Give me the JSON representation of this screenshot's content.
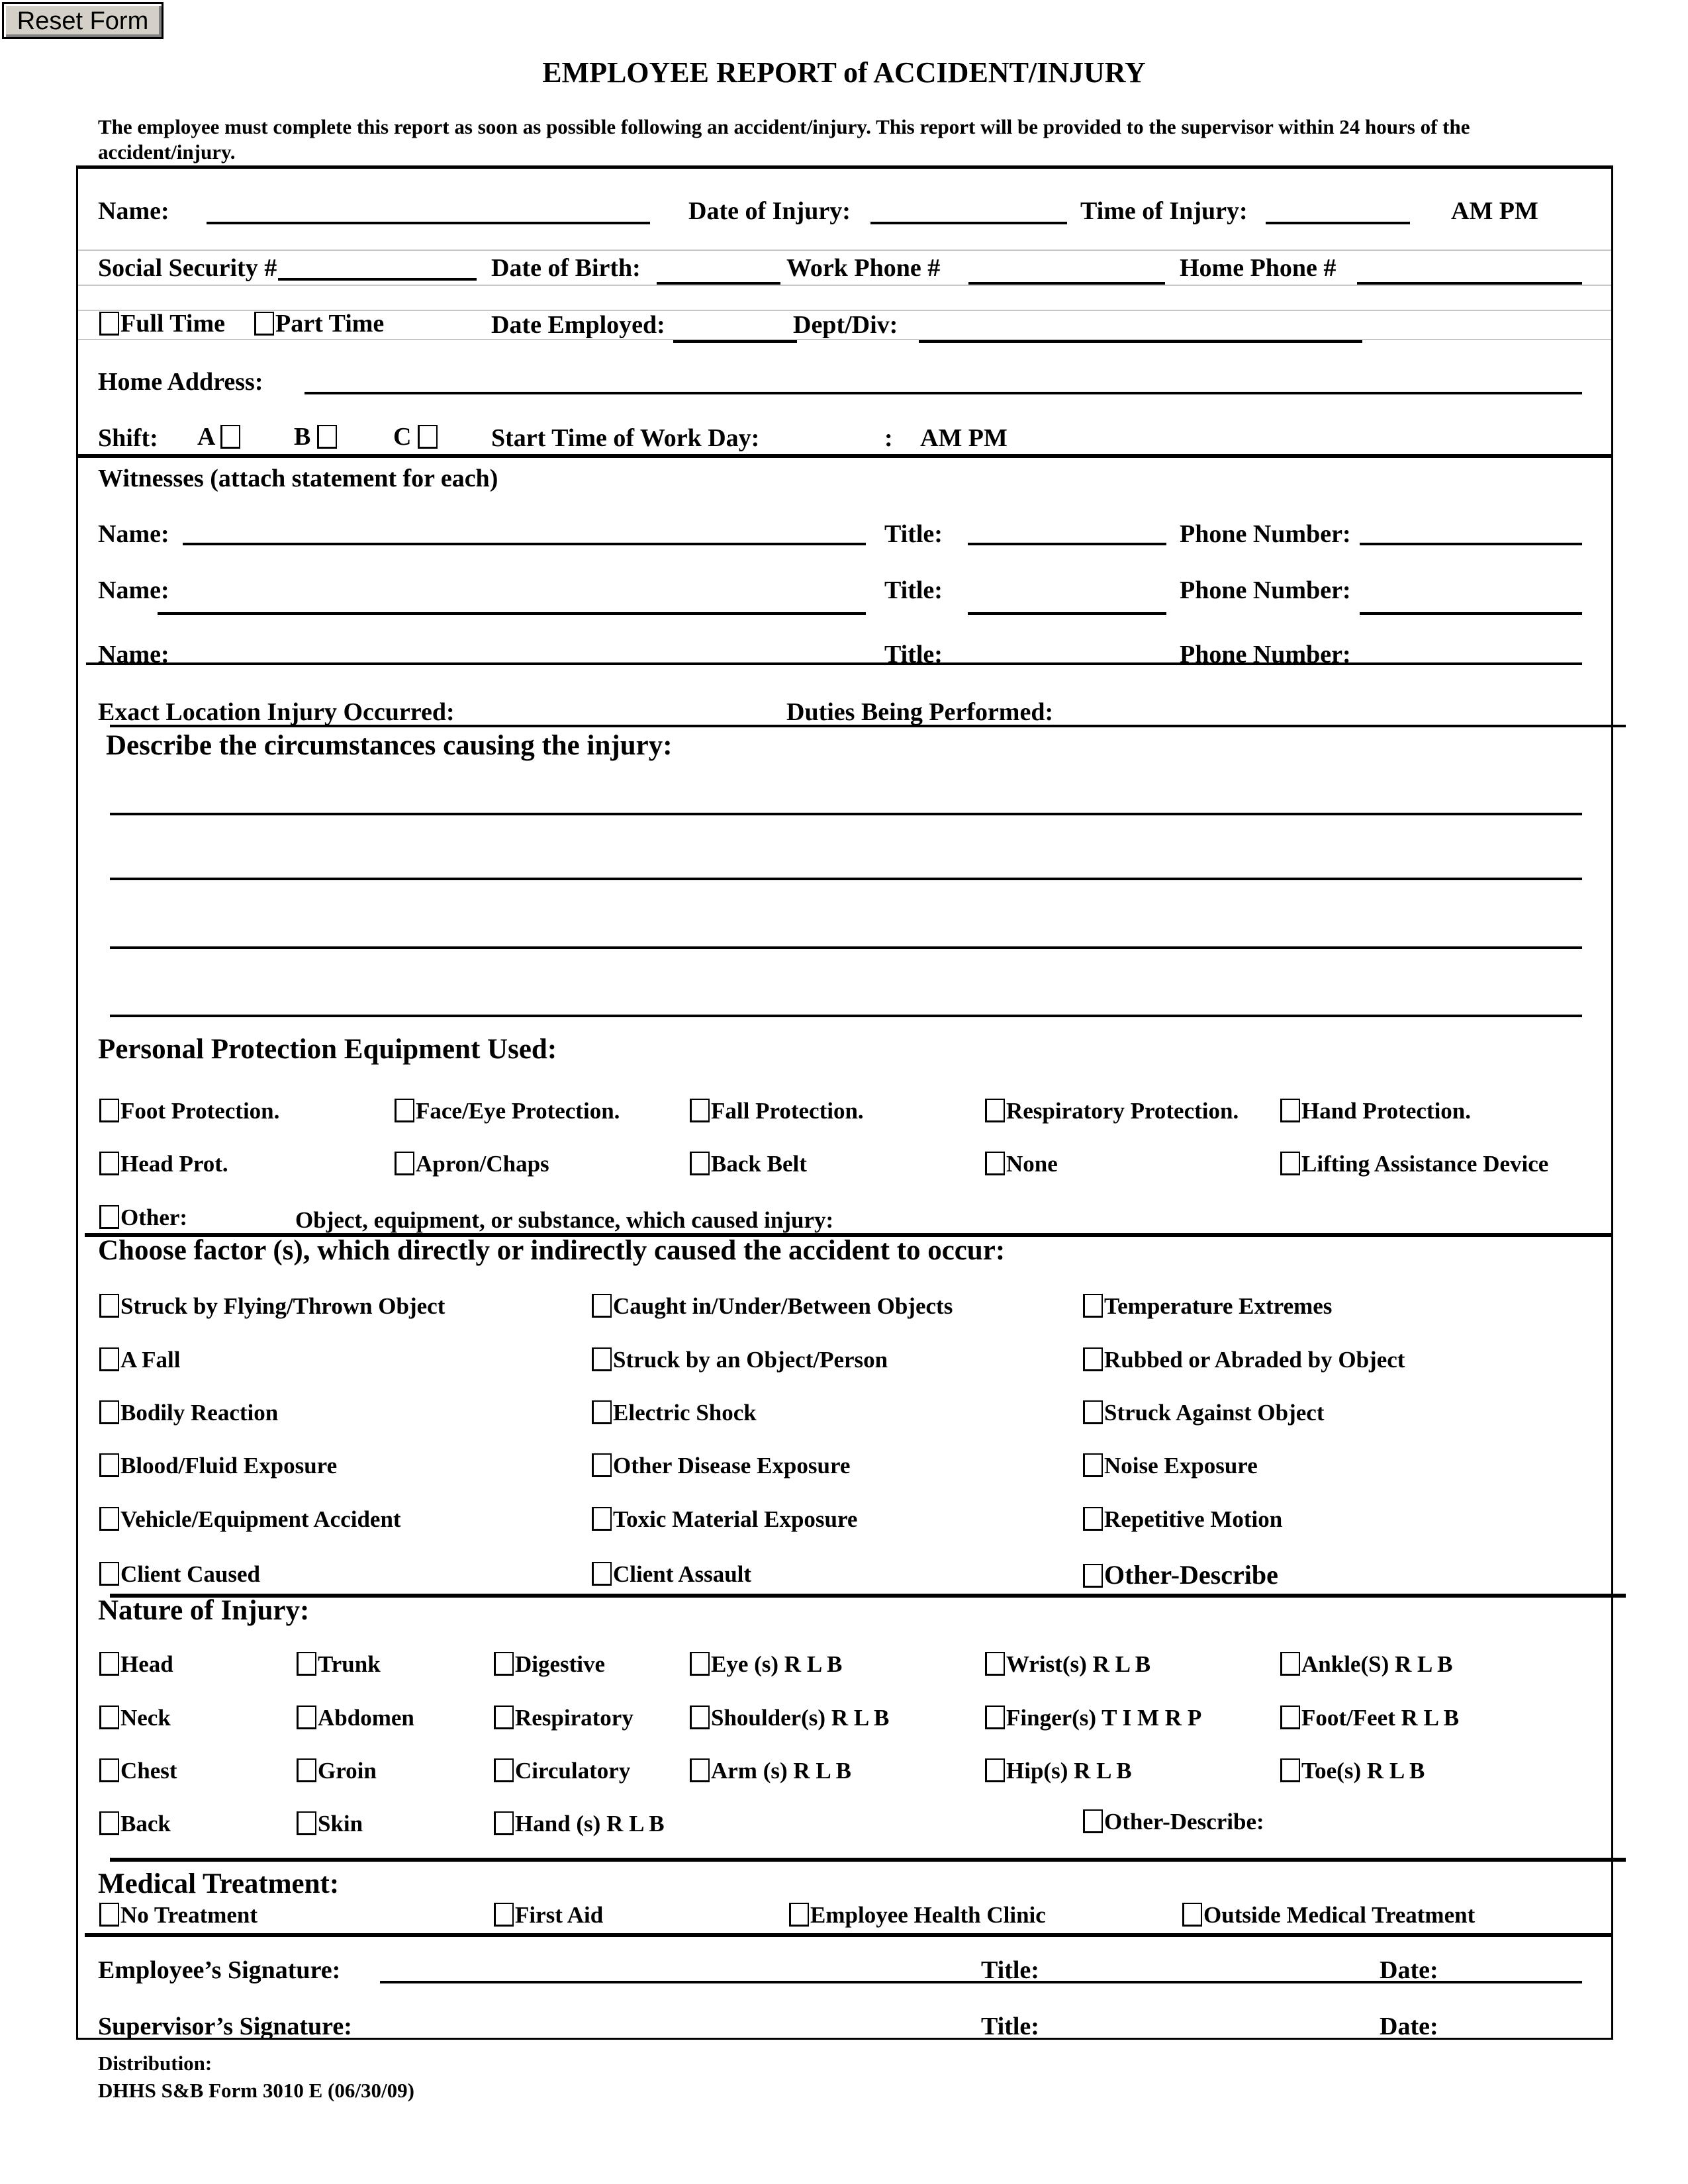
{
  "reset_button": "Reset Form",
  "title": "EMPLOYEE REPORT of ACCIDENT/INJURY",
  "intro_line1": "The employee must complete this report as soon as possible following an accident/injury.  This report will be provided to the supervisor within 24 hours of the",
  "intro_line2": "accident/injury.",
  "employee": {
    "name_label": "Name:",
    "date_of_injury_label": "Date of Injury:",
    "time_of_injury_label": "Time of Injury:",
    "am_pm": "AM  PM",
    "ssn_label": "Social Security #",
    "dob_label": "Date of Birth:",
    "work_phone_label": "Work Phone #",
    "home_phone_label": "Home Phone #",
    "full_time": "Full Time",
    "part_time": "Part Time",
    "date_employed_label": "Date Employed:",
    "dept_label": "Dept/Div:",
    "home_address_label": "Home Address:",
    "shift_label": "Shift:",
    "shift_a": "A",
    "shift_b": "B",
    "shift_c": "C",
    "start_time_label": "Start Time of Work Day:",
    "start_time_sep": ":",
    "start_am_pm": "AM  PM"
  },
  "witnesses": {
    "heading": "Witnesses (attach statement for each)",
    "name_label": "Name:",
    "title_label": "Title:",
    "phone_label": "Phone Number:"
  },
  "location": {
    "exact_location_label": "Exact Location Injury Occurred:",
    "duties_label": "Duties Being Performed:"
  },
  "circumstances_heading": "Describe the circumstances causing the injury:",
  "ppe": {
    "heading": "Personal Protection Equipment Used:",
    "row1": [
      "Foot Protection.",
      "Face/Eye Protection.",
      "Fall Protection.",
      "Respiratory Protection.",
      "Hand Protection."
    ],
    "row2": [
      "Head Prot.",
      "Apron/Chaps",
      "Back Belt",
      "None",
      "Lifting Assistance Device"
    ],
    "other": "Other:",
    "object_label": "Object, equipment, or substance, which caused injury:"
  },
  "factors": {
    "heading": "Choose factor (s), which directly or indirectly caused the accident to occur:",
    "col1": [
      "Struck by Flying/Thrown Object",
      "A Fall",
      "Bodily Reaction",
      "Blood/Fluid Exposure",
      "Vehicle/Equipment Accident",
      "Client Caused"
    ],
    "col2": [
      "Caught in/Under/Between Objects",
      "Struck by an Object/Person",
      "Electric Shock",
      "Other Disease Exposure",
      "Toxic Material Exposure",
      "Client Assault"
    ],
    "col3": [
      "Temperature Extremes",
      "Rubbed or Abraded by Object",
      "Struck Against Object",
      "Noise Exposure",
      "Repetitive Motion",
      "Other-Describe"
    ]
  },
  "nature": {
    "heading": "Nature of Injury:",
    "rows": [
      [
        "Head",
        "Trunk",
        "Digestive",
        "Eye (s) R  L  B",
        "Wrist(s) R  L  B",
        "Ankle(S) R  L  B"
      ],
      [
        "Neck",
        "Abdomen",
        "Respiratory",
        "Shoulder(s) R  L  B",
        "Finger(s) T I M R P",
        "Foot/Feet R  L  B"
      ],
      [
        "Chest",
        "Groin",
        "Circulatory",
        "Arm (s) R  L  B",
        "Hip(s) R  L  B",
        "Toe(s) R  L  B"
      ],
      [
        "Back",
        "Skin",
        "Hand (s) R  L  B"
      ]
    ],
    "other": "Other-Describe:"
  },
  "medical": {
    "heading": "Medical Treatment:",
    "options": [
      "No Treatment",
      "First Aid",
      "Employee Health Clinic",
      "Outside Medical Treatment"
    ]
  },
  "signatures": {
    "employee_label": "Employee’s Signature:",
    "supervisor_label": "Supervisor’s Signature:",
    "title_label": "Title:",
    "date_label": "Date:"
  },
  "footer": {
    "distribution": "Distribution:",
    "form_id": "DHHS S&B Form 3010 E (06/30/09)"
  }
}
